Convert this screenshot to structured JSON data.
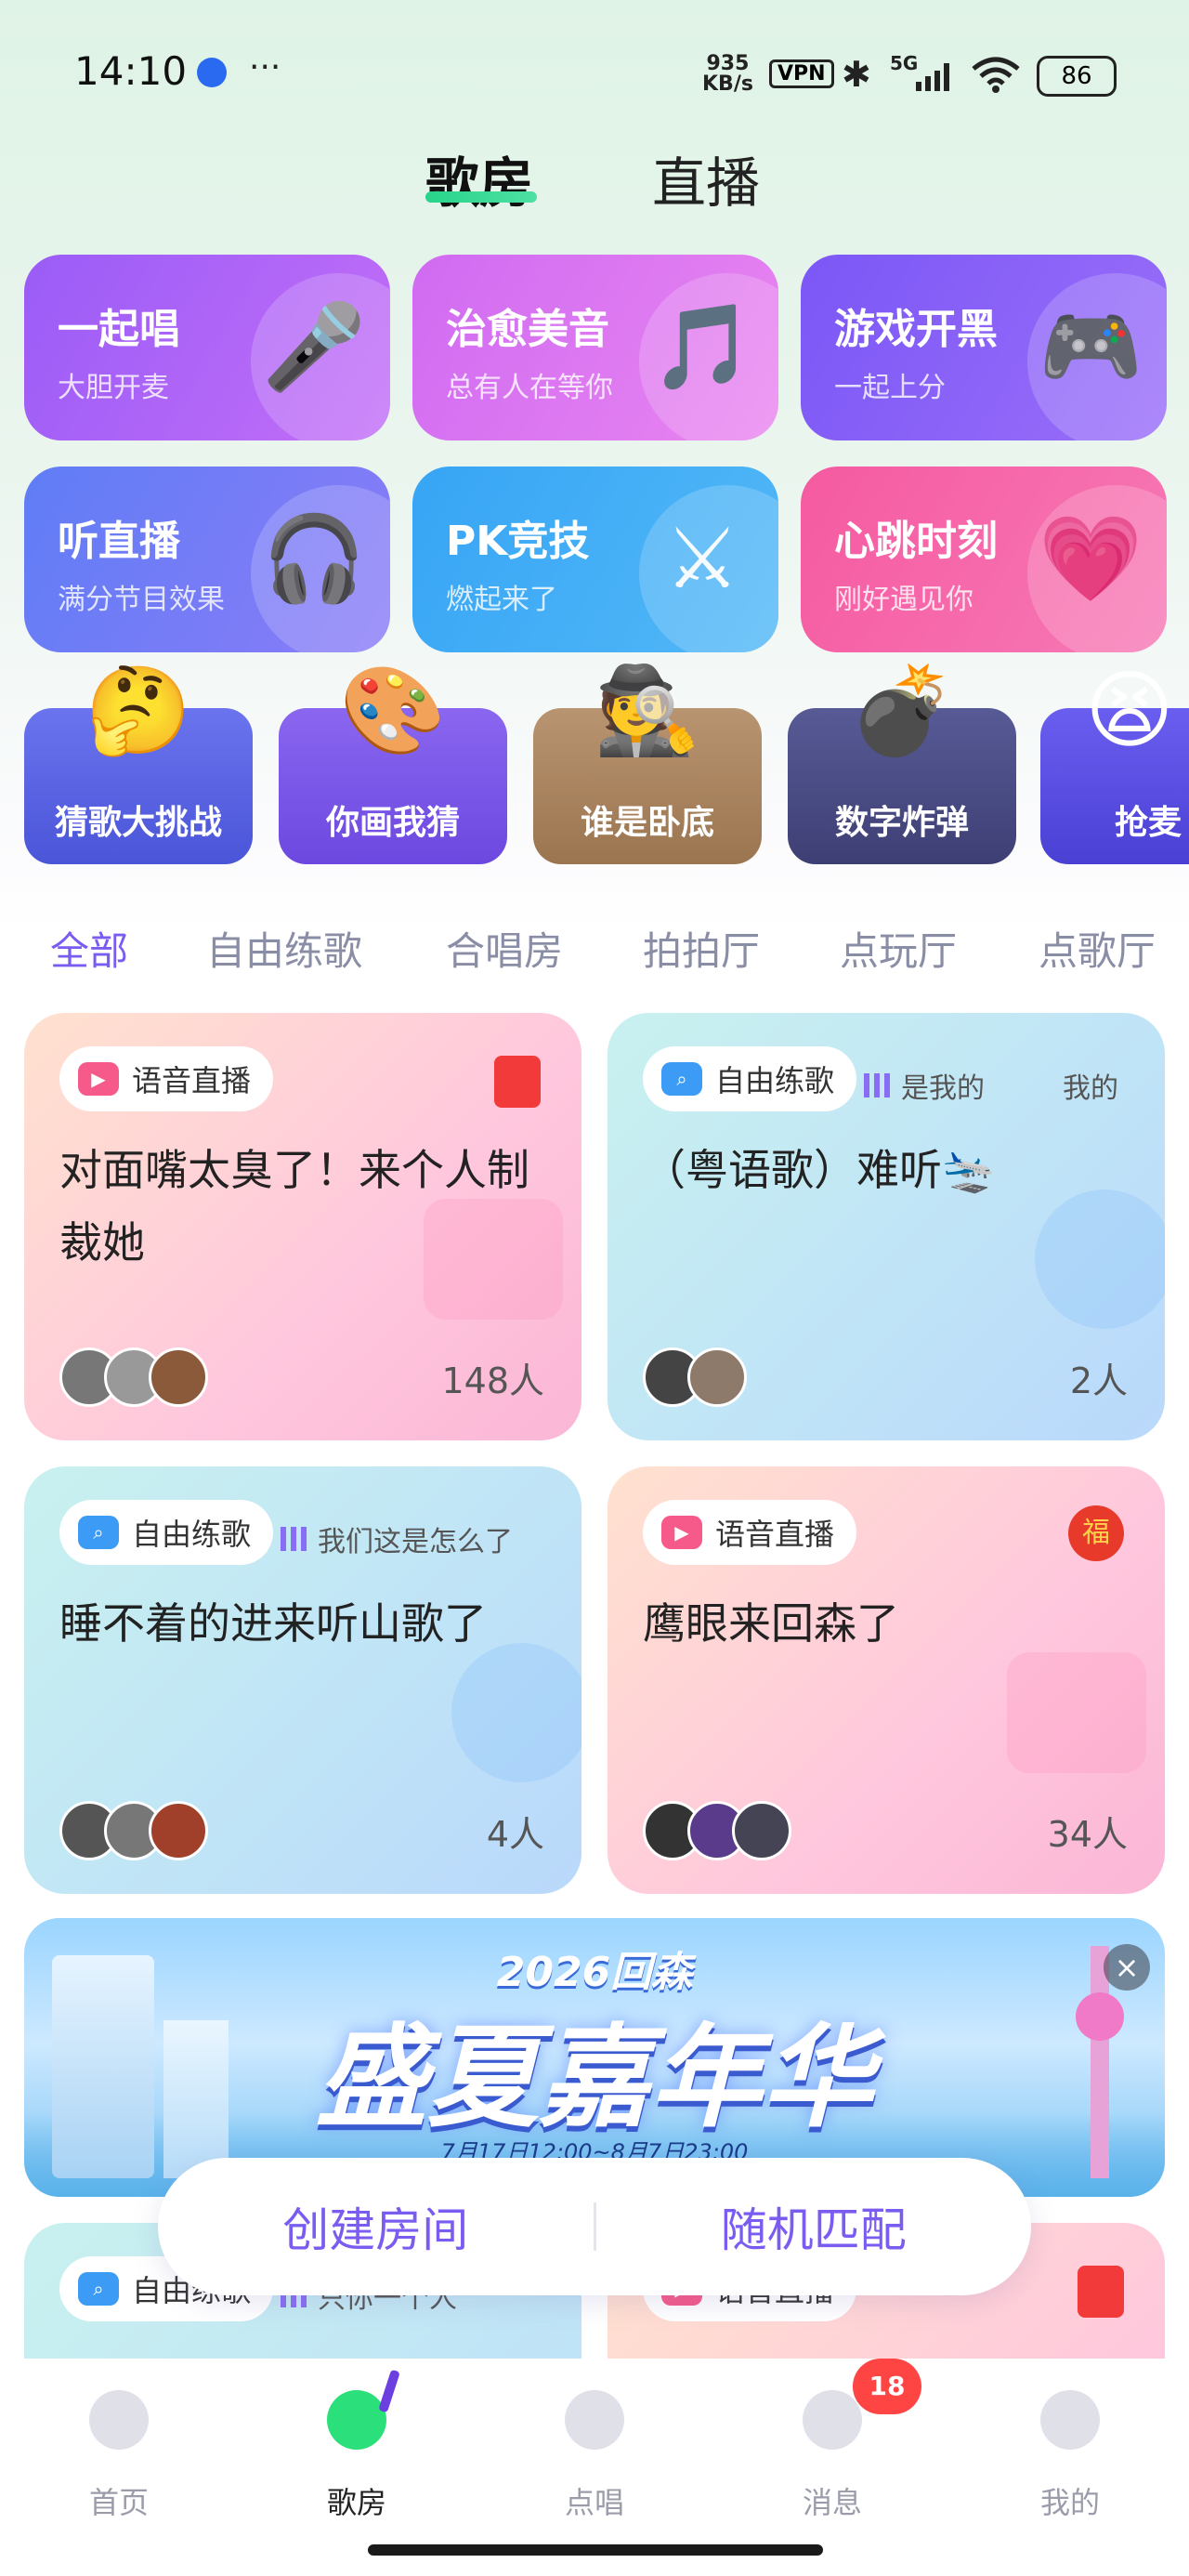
{
  "status_bar": {
    "time": "14:10",
    "speed_top": "935",
    "speed_bottom": "KB/s",
    "vpn": "VPN",
    "network": "5G",
    "battery": "86"
  },
  "top_tabs": {
    "active": "歌房",
    "inactive": "直播"
  },
  "categories": [
    {
      "title": "一起唱",
      "subtitle": "大胆开麦",
      "icon": "microphone-icon",
      "color_from": "#9a5cf7",
      "color_to": "#c36ef7"
    },
    {
      "title": "治愈美音",
      "subtitle": "总有人在等你",
      "icon": "music-note-icon",
      "color_from": "#d06bf2",
      "color_to": "#e985f0"
    },
    {
      "title": "游戏开黑",
      "subtitle": "一起上分",
      "icon": "gamepad-icon",
      "color_from": "#7b57f6",
      "color_to": "#9a6ef9"
    },
    {
      "title": "听直播",
      "subtitle": "满分节目效果",
      "icon": "headphones-icon",
      "color_from": "#5f7df6",
      "color_to": "#8b7cf7"
    },
    {
      "title": "PK竞技",
      "subtitle": "燃起来了",
      "icon": "crossed-swords-icon",
      "color_from": "#37a5f5",
      "color_to": "#52b8f7"
    },
    {
      "title": "心跳时刻",
      "subtitle": "刚好遇见你",
      "icon": "heart-icon",
      "color_from": "#f55aa0",
      "color_to": "#f779b6"
    }
  ],
  "games": [
    {
      "label": "猜歌大挑战",
      "icon": "thinking-emoji-icon",
      "glyph": "🤔",
      "color": "#5862e6"
    },
    {
      "label": "你画我猜",
      "icon": "palette-icon",
      "glyph": "🎨",
      "color": "#7a56e8"
    },
    {
      "label": "谁是卧底",
      "icon": "detective-hat-icon",
      "glyph": "🕵",
      "color": "#a9845d"
    },
    {
      "label": "数字炸弹",
      "icon": "bomb-icon",
      "glyph": "💣",
      "color": "#4a4c86"
    },
    {
      "label": "抢麦",
      "icon": "shouting-emoji-icon",
      "glyph": "😫",
      "color": "#5a4fe0"
    }
  ],
  "filter_tabs": [
    "全部",
    "自由练歌",
    "合唱房",
    "拍拍厅",
    "点玩厅",
    "点歌厅"
  ],
  "rooms": [
    {
      "tag": "语音直播",
      "tag_icon": "tv-icon",
      "title": "对面嘴太臭了！来个人制裁她",
      "now_playing": "",
      "count": "148人",
      "badge": "red-envelope-icon",
      "style": "pink"
    },
    {
      "tag": "自由练歌",
      "tag_icon": "search-icon",
      "title": "（粤语歌）难听🛬",
      "now_playing": "是我的",
      "now_playing_2": "我的",
      "count": "2人",
      "badge": "",
      "style": "blue"
    },
    {
      "tag": "自由练歌",
      "tag_icon": "search-icon",
      "title": "睡不着的进来听山歌了",
      "now_playing": "我们这是怎么了",
      "count": "4人",
      "badge": "",
      "style": "blue"
    },
    {
      "tag": "语音直播",
      "tag_icon": "tv-icon",
      "title": "鹰眼来回森了",
      "now_playing": "",
      "count": "34人",
      "badge": "lucky-bag-icon",
      "style": "pink"
    }
  ],
  "partial_rooms": [
    {
      "tag": "自由练歌",
      "now_playing": "只你一个人"
    },
    {
      "tag": "语音直播"
    }
  ],
  "banner": {
    "kicker": "2026回森",
    "title": "盛夏嘉年华",
    "date": "7月17日12:00~8月7日23:00"
  },
  "actions": {
    "create": "创建房间",
    "match": "随机匹配"
  },
  "nav": [
    {
      "label": "首页",
      "icon": "home-tree-icon",
      "active": false
    },
    {
      "label": "歌房",
      "icon": "music-room-icon",
      "active": true
    },
    {
      "label": "点唱",
      "icon": "sing-bubble-icon",
      "active": false
    },
    {
      "label": "消息",
      "icon": "message-bubble-icon",
      "active": false,
      "badge": "18"
    },
    {
      "label": "我的",
      "icon": "profile-face-icon",
      "active": false
    }
  ]
}
